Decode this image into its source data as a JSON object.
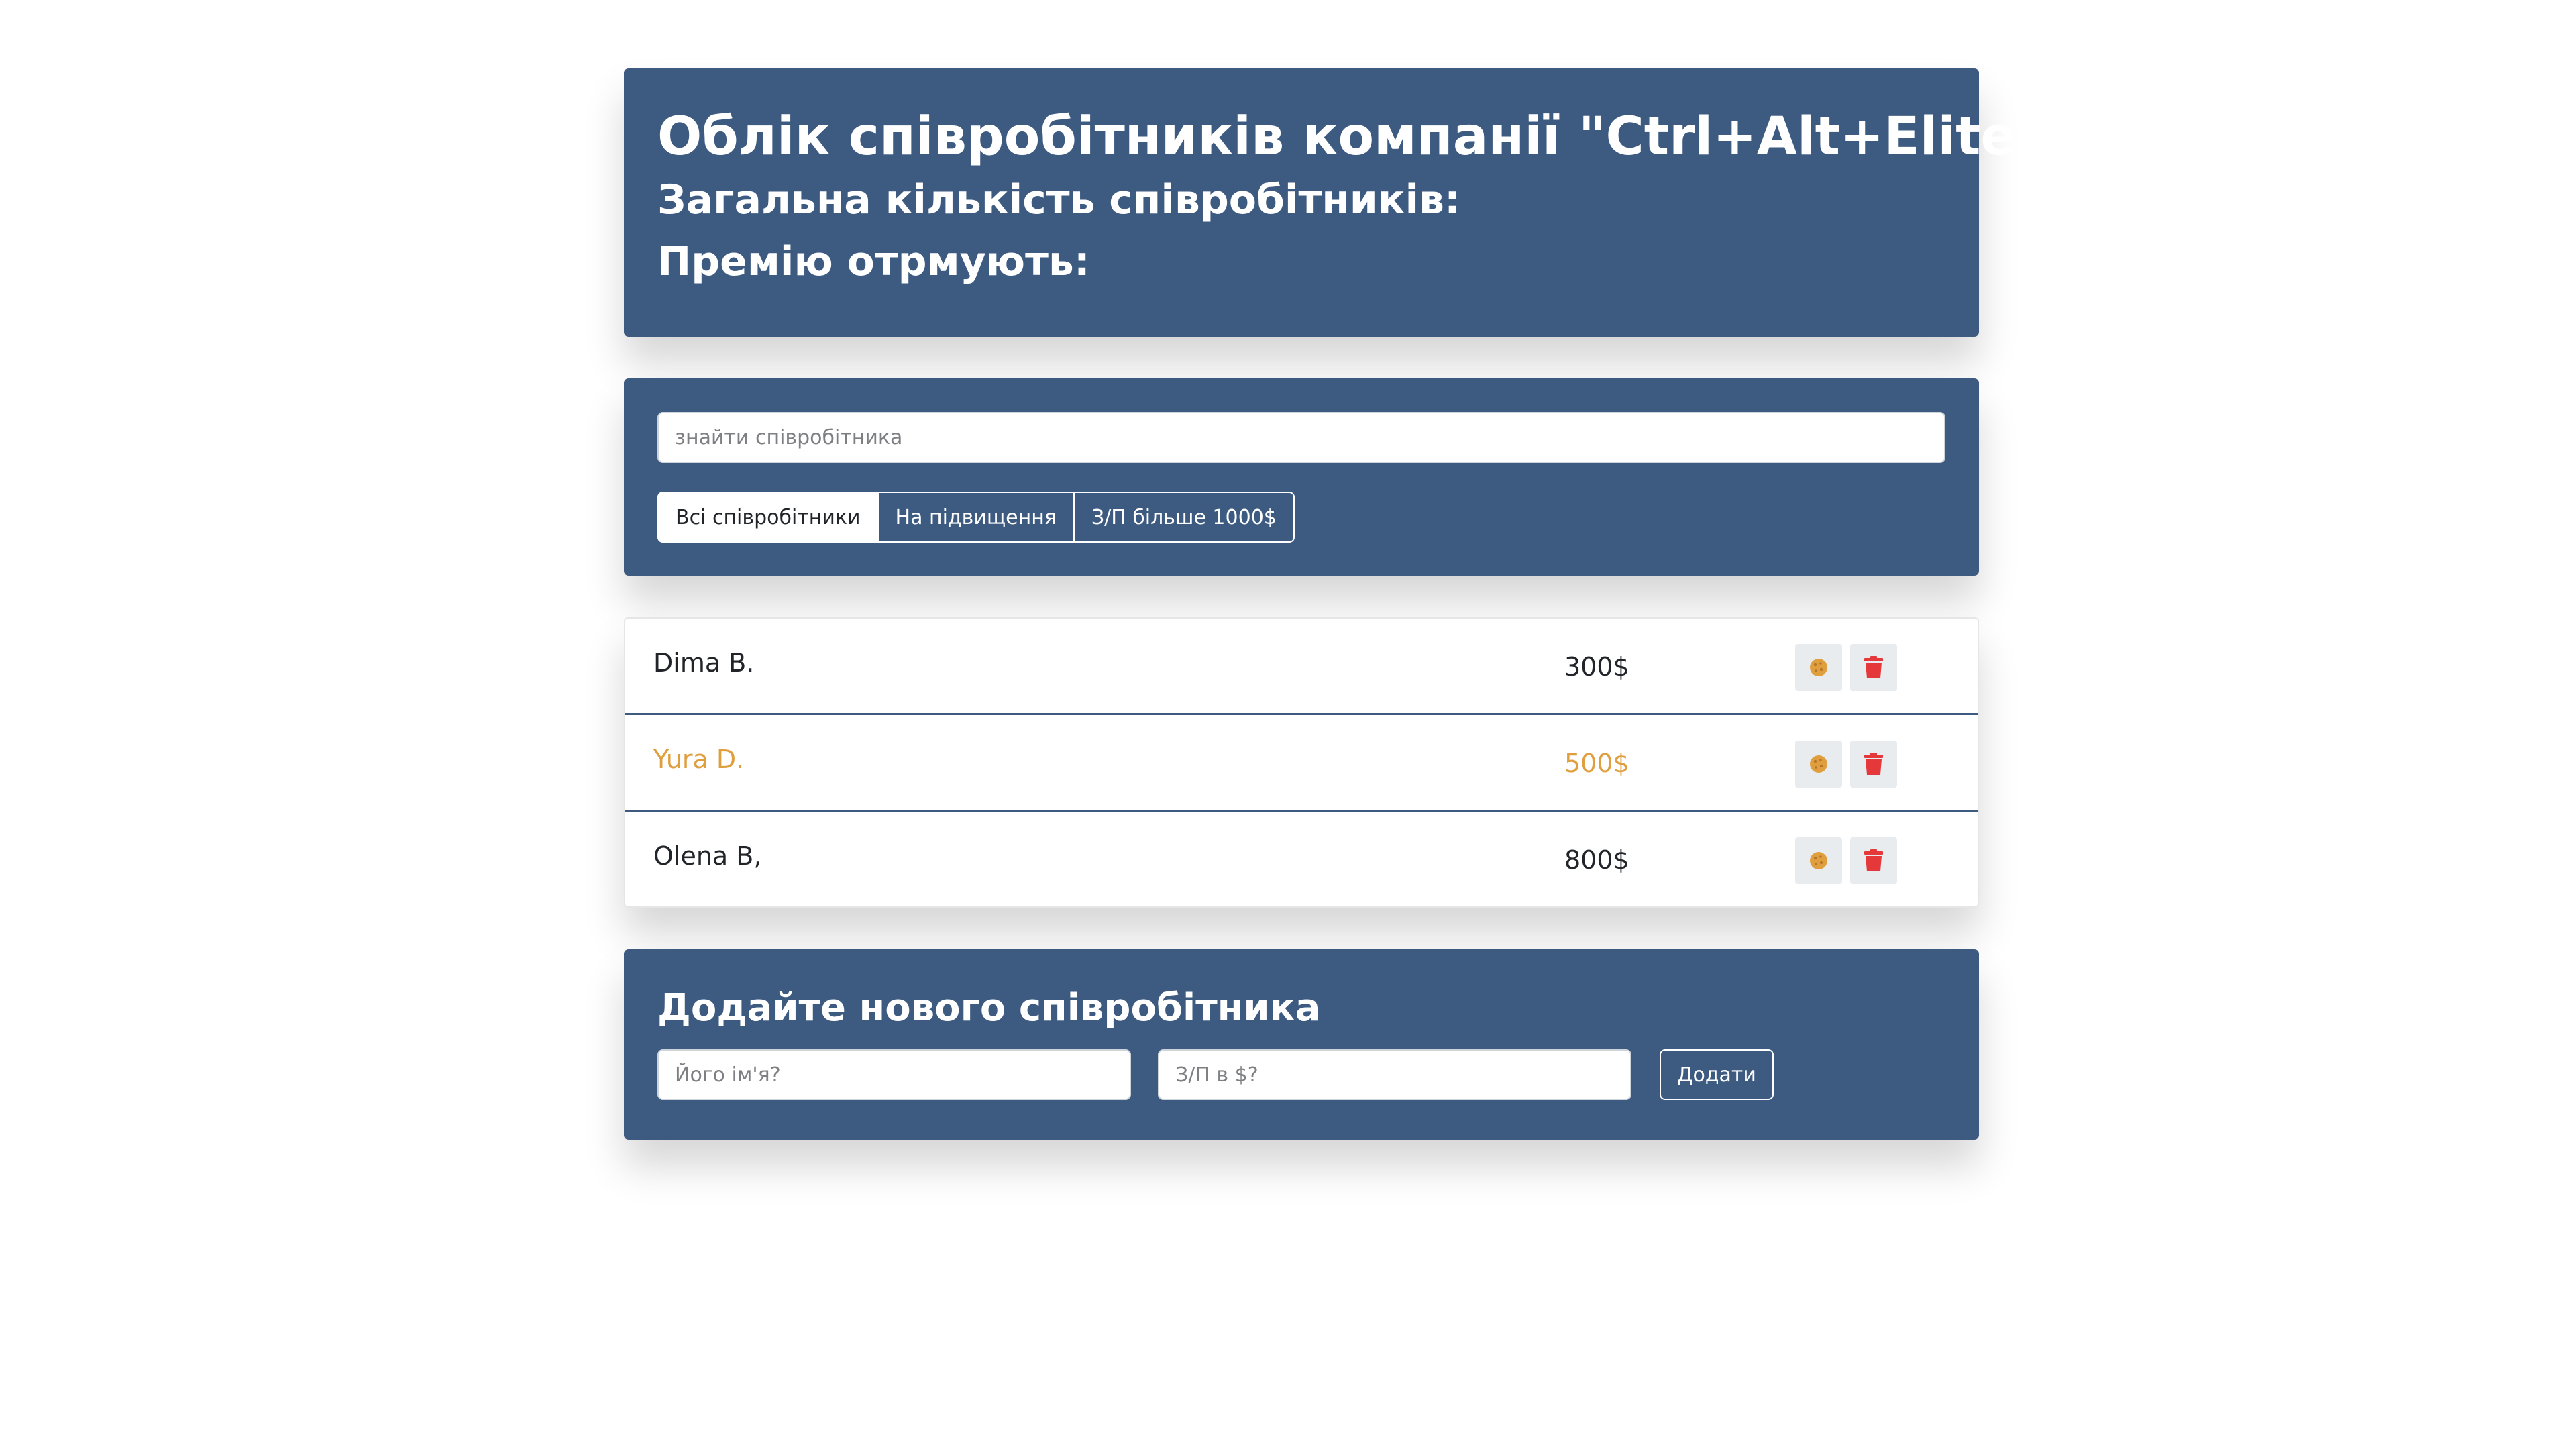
{
  "info": {
    "title": "Облік співробітників компанії \"Ctrl+Alt+Elite\"",
    "total_label": "Загальна кількість співробітників:",
    "bonus_label": "Премію отрмують:"
  },
  "search": {
    "placeholder": "знайти співробітника"
  },
  "filters": [
    {
      "label": "Всі співробітники",
      "active": true
    },
    {
      "label": "На підвищення",
      "active": false
    },
    {
      "label": "З/П більше 1000$",
      "active": false
    }
  ],
  "employees": [
    {
      "name": "Dima B.",
      "salary": "300$",
      "highlighted": false
    },
    {
      "name": "Yura D.",
      "salary": "500$",
      "highlighted": true
    },
    {
      "name": "Olena B,",
      "salary": "800$",
      "highlighted": false
    }
  ],
  "add_form": {
    "title": "Додайте нового співробітника",
    "name_placeholder": "Його ім'я?",
    "salary_placeholder": "З/П в $?",
    "submit_label": "Додати"
  },
  "colors": {
    "panel_background": "#3d5a80",
    "highlight": "#e09f3e",
    "delete_icon": "#e5383b",
    "cookie_icon": "#e09f3e"
  },
  "icons": {
    "bonus": "cookie-icon",
    "delete": "trash-icon"
  }
}
